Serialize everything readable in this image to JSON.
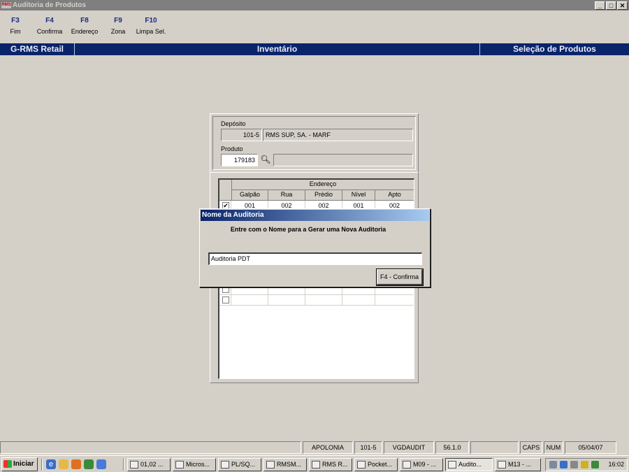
{
  "window": {
    "title": "Auditoria de Produtos",
    "icon_text": "RMS",
    "controls": [
      "_",
      "□",
      "✕"
    ]
  },
  "fkeys": [
    {
      "key": "F3",
      "label": "Fim"
    },
    {
      "key": "F4",
      "label": "Confirma"
    },
    {
      "key": "F8",
      "label": "Endereço"
    },
    {
      "key": "F9",
      "label": "Zona"
    },
    {
      "key": "F10",
      "label": "Limpa Sel."
    }
  ],
  "header": {
    "left": "G-RMS Retail",
    "center": "Inventário",
    "right": "Seleção de Produtos"
  },
  "form": {
    "deposito_label": "Depósito",
    "deposito_code": "101-5",
    "deposito_name": "RMS SUP, SA. - MARF",
    "produto_label": "Produto",
    "produto_code": "179183",
    "produto_desc": ""
  },
  "grid": {
    "group_header": "Endereço",
    "columns": [
      "Galpão",
      "Rua",
      "Prédio",
      "Nível",
      "Apto"
    ],
    "rows": [
      {
        "checked": true,
        "cells": [
          "001",
          "002",
          "002",
          "001",
          "002"
        ]
      }
    ],
    "empty_rows": 9
  },
  "dialog": {
    "title": "Nome da Auditoria",
    "message": "Entre com o Nome para a Gerar uma Nova Auditoria",
    "input_value": "Auditoria PDT",
    "button_label": "F4 - Confirma"
  },
  "status": {
    "host": "APOLONIA",
    "store": "101-5",
    "module": "VGDAUDIT",
    "version": "56.1.0",
    "caps": "CAPS",
    "num": "NUM",
    "date": "05/04/07"
  },
  "taskbar": {
    "start": "Iniciar",
    "buttons": [
      "01,02 ...",
      "Micros...",
      "PL/SQ...",
      "RMSM...",
      "RMS R...",
      "Pocket...",
      "M09 - ...",
      "Audito...",
      "M13 - ..."
    ],
    "clock": "16:02"
  }
}
